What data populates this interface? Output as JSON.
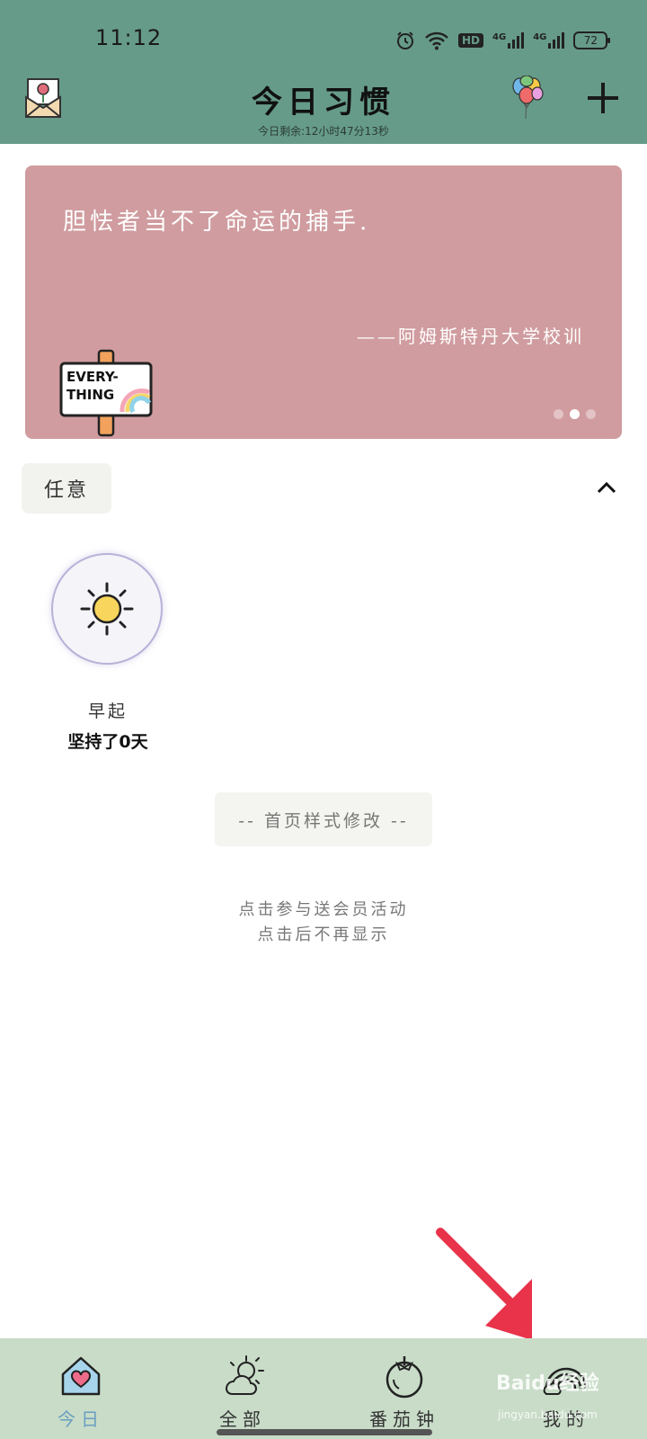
{
  "status_bar": {
    "time": "11:12",
    "hd_label": "HD",
    "net_label_1": "4G",
    "net_label_2": "4G",
    "battery": "72"
  },
  "header": {
    "title": "今日习惯",
    "subtitle": "今日剩余:12小时47分13秒",
    "left_icon": "mail-icon",
    "balloon_icon": "balloons-icon",
    "add_icon": "plus-icon"
  },
  "quote_card": {
    "text": "胆怯者当不了命运的捕手.",
    "author": "——阿姆斯特丹大学校训",
    "sticker_line1": "EVERY-",
    "sticker_line2": "THING",
    "active_dot": 1,
    "dot_count": 3
  },
  "category": {
    "label": "任意"
  },
  "habits": [
    {
      "name": "早起",
      "streak": "坚持了0天",
      "icon": "sun-icon"
    }
  ],
  "style_button": "-- 首页样式修改 --",
  "promo": {
    "line1": "点击参与送会员活动",
    "line2": "点击后不再显示"
  },
  "bottom_nav": [
    {
      "label": "今日",
      "icon": "home-heart-icon",
      "active": true
    },
    {
      "label": "全部",
      "icon": "sun-cloud-icon",
      "active": false
    },
    {
      "label": "番茄钟",
      "icon": "tomato-icon",
      "active": false
    },
    {
      "label": "我的",
      "icon": "rainbow-icon",
      "active": false
    }
  ],
  "watermark": {
    "text": "Baidu经验",
    "sub": "jingyan.baidu.com"
  },
  "colors": {
    "header_bg": "#669b89",
    "card_bg": "#d09c9f",
    "nav_bg": "#c8dcc8",
    "active_nav": "#6a9ec0",
    "annotation_arrow": "#e8334a"
  }
}
